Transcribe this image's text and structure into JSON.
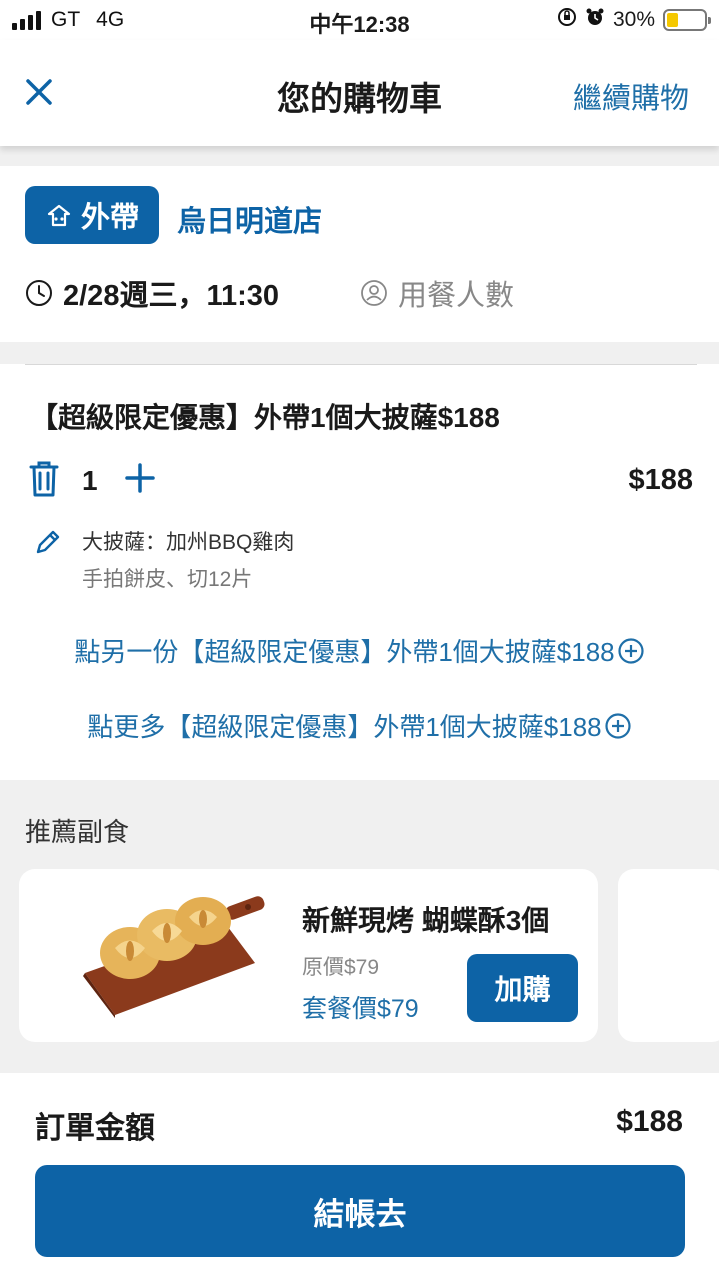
{
  "status_bar": {
    "carrier": "GT",
    "network": "4G",
    "time": "中午12:38",
    "battery_percent": "30%",
    "battery_level": 0.3,
    "icons": [
      "signal-icon",
      "orientation-lock-icon",
      "alarm-icon",
      "battery-icon"
    ]
  },
  "nav": {
    "title": "您的購物車",
    "continue_label": "繼續購物",
    "close_icon": "close-icon"
  },
  "store": {
    "mode_label": "外帶",
    "name": "烏日明道店",
    "datetime": "2/28週三，11:30",
    "diners_placeholder": "用餐人數"
  },
  "cart_item": {
    "title": "【超級限定優惠】外帶1個大披薩$188",
    "quantity": "1",
    "price": "$188",
    "option_main": "大披薩：加州BBQ雞肉",
    "option_sub": "手拍餅皮、切12片",
    "add_another_label": "點另一份【超級限定優惠】外帶1個大披薩$188",
    "add_more_label": "點更多【超級限定優惠】外帶1個大披薩$188"
  },
  "recommend": {
    "section_title": "推薦副食",
    "items": [
      {
        "name": "新鮮現烤 蝴蝶酥3個",
        "original_price": "原價$79",
        "set_price": "套餐價$79",
        "add_label": "加購"
      }
    ]
  },
  "footer": {
    "total_label": "訂單金額",
    "total_value": "$188",
    "checkout_label": "結帳去"
  },
  "colors": {
    "primary": "#0d63a6",
    "link": "#1f6fa8",
    "background": "#f0f0f0",
    "battery": "#f5c800"
  }
}
